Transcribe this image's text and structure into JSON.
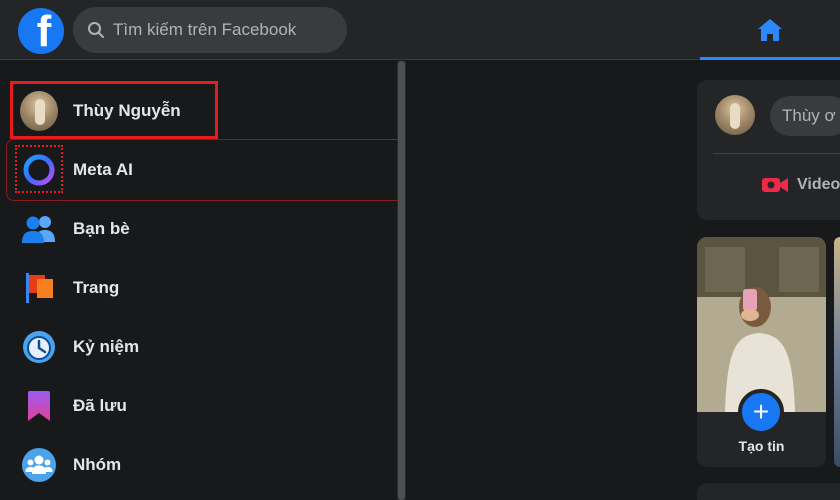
{
  "search": {
    "placeholder": "Tìm kiếm trên Facebook"
  },
  "sidebar": {
    "items": [
      {
        "label": "Thùy Nguyễn",
        "icon": "profile-avatar"
      },
      {
        "label": "Meta AI",
        "icon": "meta-ai-icon"
      },
      {
        "label": "Bạn bè",
        "icon": "friends-icon"
      },
      {
        "label": "Trang",
        "icon": "pages-flag-icon"
      },
      {
        "label": "Kỷ niệm",
        "icon": "memories-clock-icon"
      },
      {
        "label": "Đã lưu",
        "icon": "saved-bookmark-icon"
      },
      {
        "label": "Nhóm",
        "icon": "groups-icon"
      }
    ]
  },
  "composer": {
    "placeholder_visible": "Thùy ơ",
    "video_label": "Video"
  },
  "stories": {
    "create_label": "Tạo tin"
  },
  "colors": {
    "brand": "#1877f2",
    "highlight": "#e41e1e",
    "background": "#18191a",
    "card": "#242526"
  }
}
